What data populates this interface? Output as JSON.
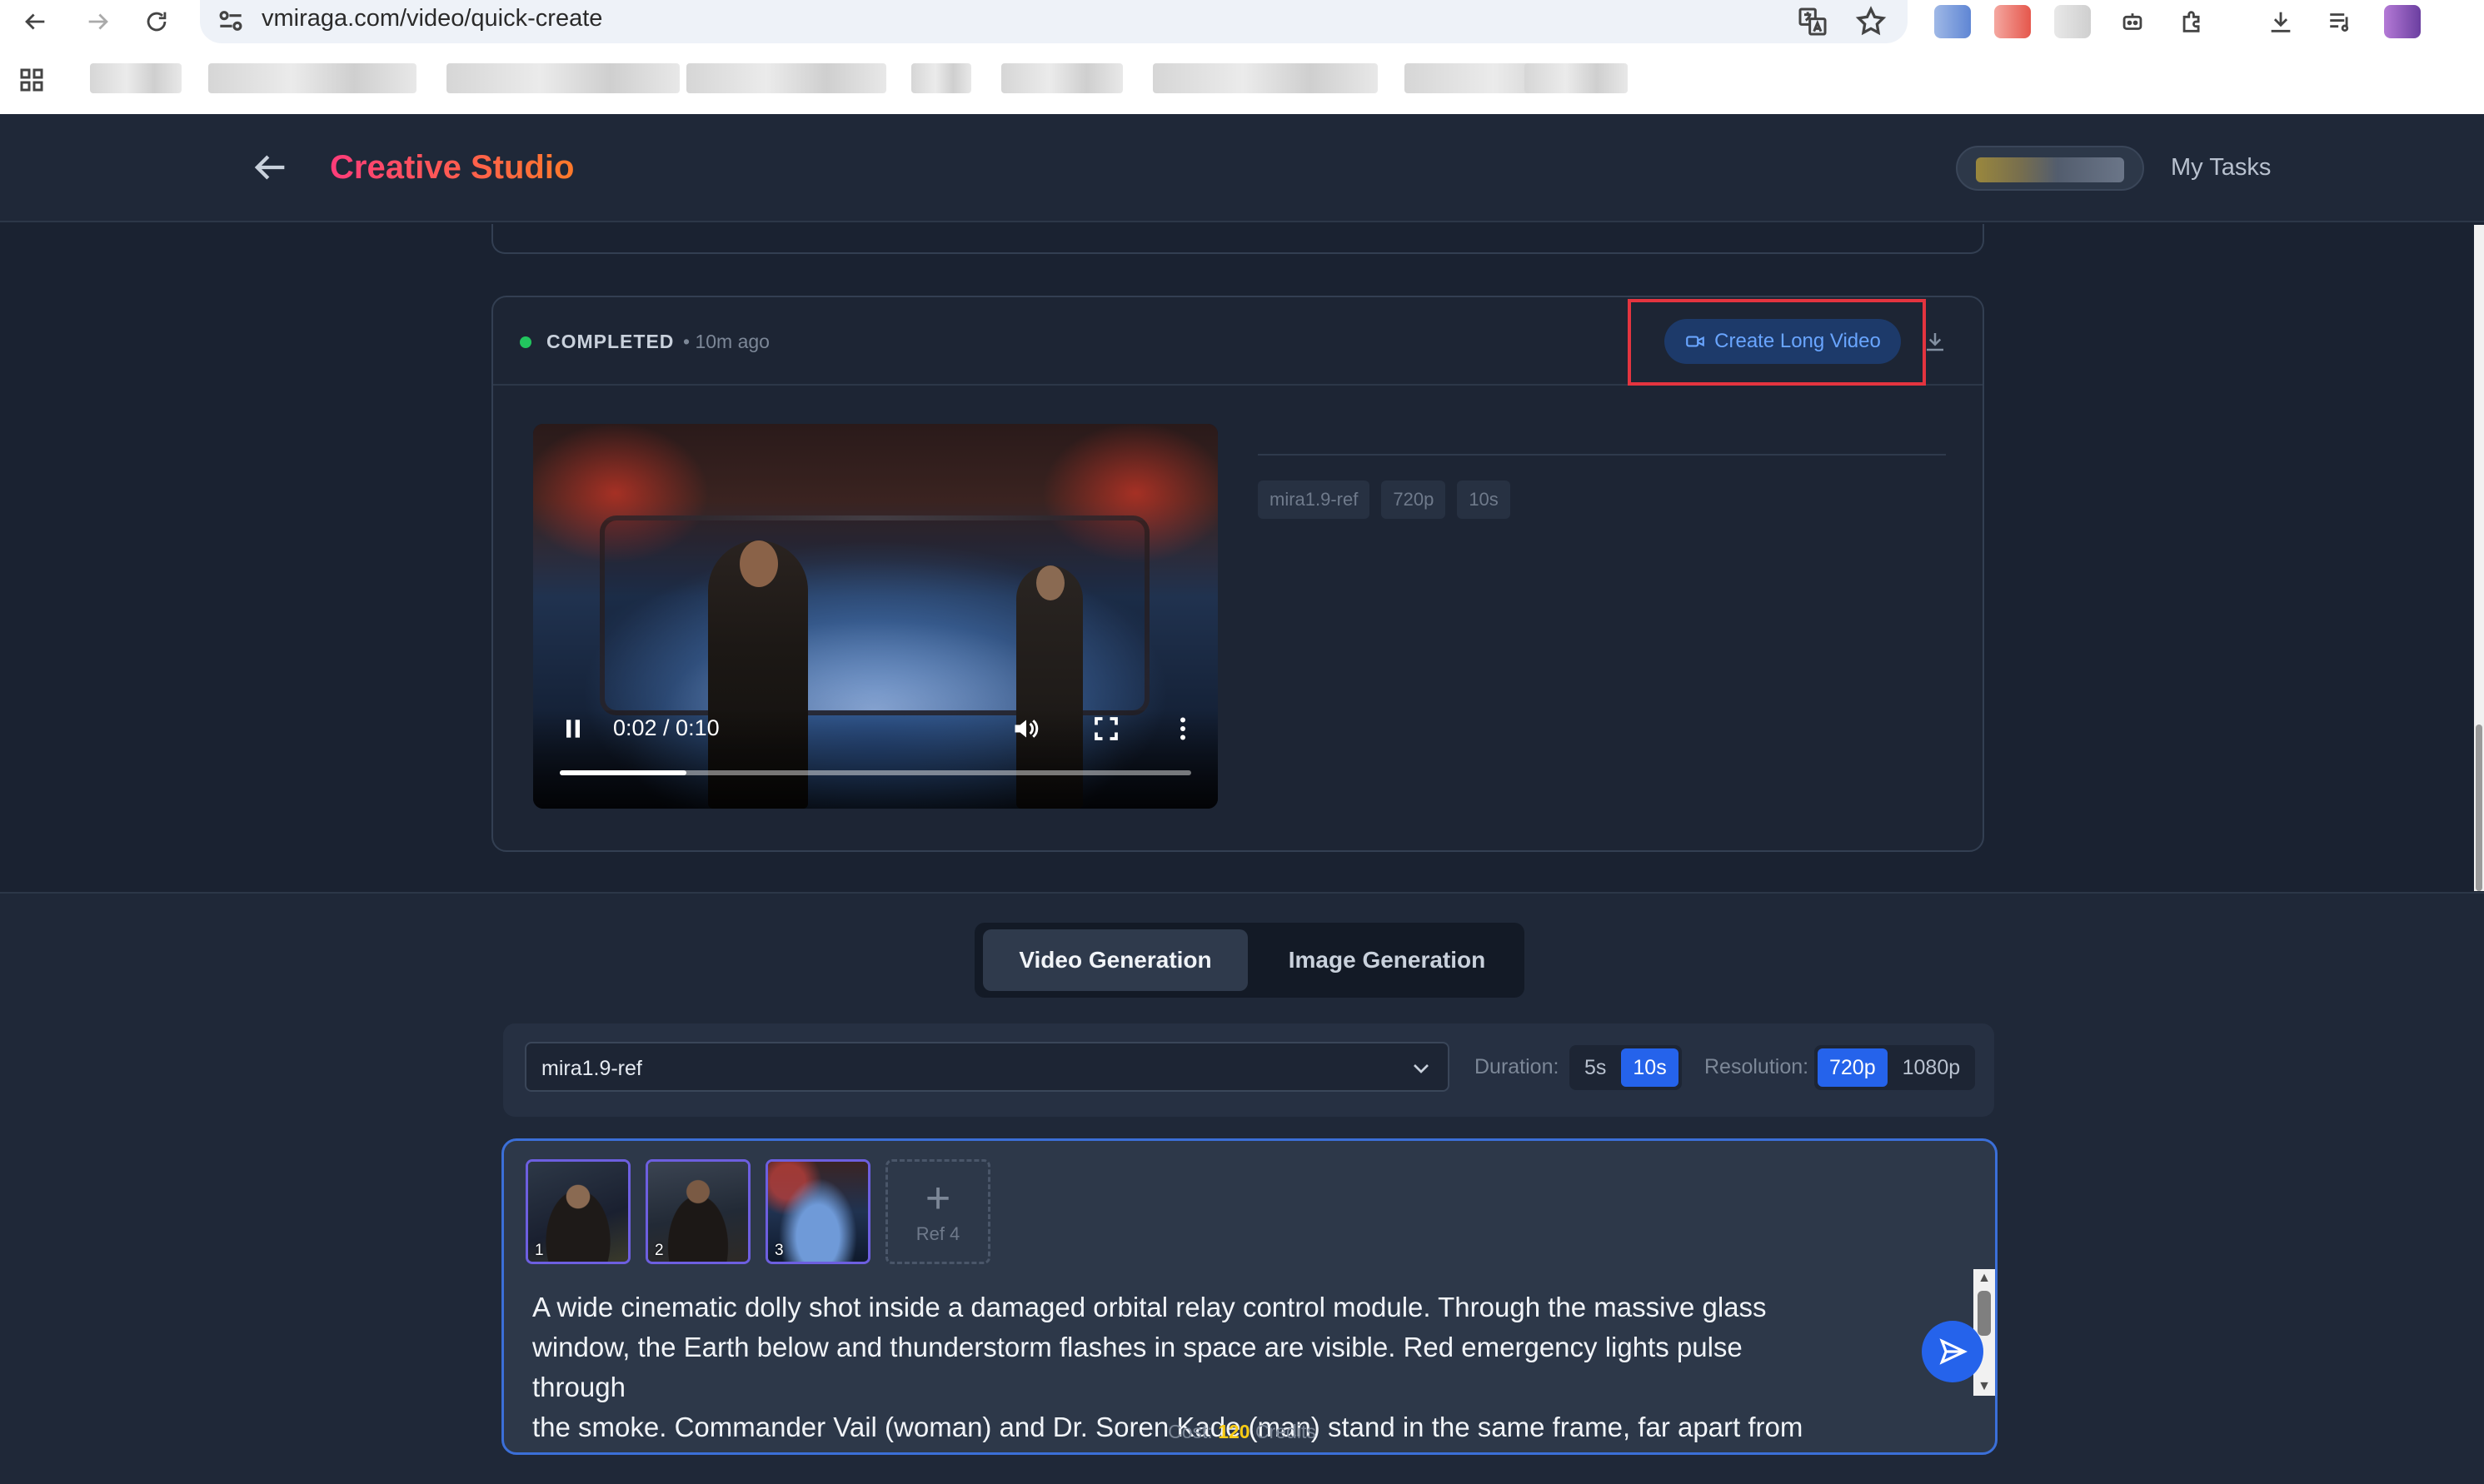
{
  "browser": {
    "url": "vmiraga.com/video/quick-create"
  },
  "header": {
    "brand": "Creative Studio",
    "my_tasks": "My Tasks"
  },
  "task": {
    "status": "COMPLETED",
    "time_ago": "• 10m ago",
    "status_color": "#22c55e",
    "create_long_video": "Create Long Video",
    "player": {
      "time": "0:02 / 0:10",
      "progress": 0.2
    },
    "tags": [
      "mira1.9-ref",
      "720p",
      "10s"
    ]
  },
  "composer": {
    "tabs": [
      "Video Generation",
      "Image Generation"
    ],
    "active_tab": "Video Generation",
    "model": "mira1.9-ref",
    "duration_label": "Duration:",
    "duration_options": [
      "5s",
      "10s"
    ],
    "duration_selected": "10s",
    "resolution_label": "Resolution:",
    "resolution_options": [
      "720p",
      "1080p"
    ],
    "resolution_selected": "720p",
    "refs": [
      {
        "label": "1"
      },
      {
        "label": "2"
      },
      {
        "label": "3"
      }
    ],
    "add_ref_label": "Ref 4",
    "prompt": "A wide cinematic dolly shot inside a damaged orbital relay control module. Through the massive glass\nwindow, the Earth below and thunderstorm flashes in space are visible. Red emergency lights pulse through\nthe smoke. Commander Vail (woman) and Dr. Soren Kade (man) stand in the same frame, far apart from each",
    "cost_label": "Cost:",
    "cost_value": "120",
    "cost_unit": "Credits",
    "accent_color": "#2563eb"
  }
}
